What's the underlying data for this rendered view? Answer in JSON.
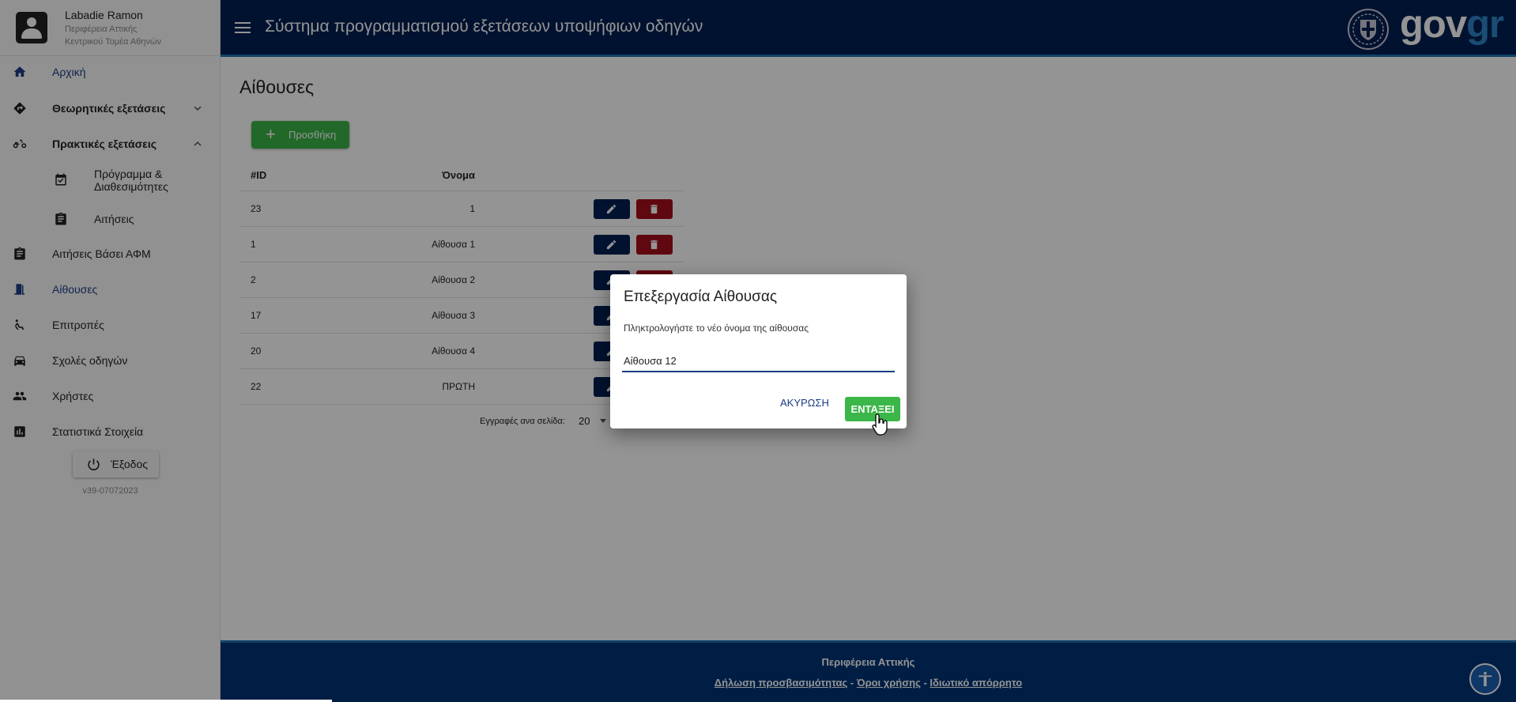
{
  "user": {
    "name": "Labadie Ramon",
    "region": "Περιφέρεια Αττικής",
    "sector": "Κεντρικού Τομέα Αθηνών"
  },
  "nav": {
    "home": "Αρχική",
    "theory": "Θεωρητικές εξετάσεις",
    "practical": "Πρακτικές εξετάσεις",
    "schedule_line1": "Πρόγραμμα &",
    "schedule_line2": "Διαθεσιμότητες",
    "requests": "Αιτήσεις",
    "requests_afm": "Αιτήσεις Βάσει ΑΦΜ",
    "rooms": "Αίθουσες",
    "committees": "Επιτροπές",
    "schools": "Σχολές οδηγών",
    "users": "Χρήστες",
    "stats": "Στατιστικά Στοιχεία"
  },
  "logout_label": "Έξοδος",
  "version": "v39-07072023",
  "header": {
    "title": "Σύστημα προγραμματισμού εξετάσεων υποψήφιων οδηγών",
    "brand_gov": "gov",
    "brand_gr": "gr"
  },
  "page": {
    "title": "Αίθουσες",
    "add_label": "Προσθήκη"
  },
  "table": {
    "columns": [
      "#ID",
      "Όνομα"
    ],
    "rows": [
      {
        "id": "23",
        "name": "1"
      },
      {
        "id": "1",
        "name": "Αίθουσα 1"
      },
      {
        "id": "2",
        "name": "Αίθουσα 2"
      },
      {
        "id": "17",
        "name": "Αίθουσα 3"
      },
      {
        "id": "20",
        "name": "Αίθουσα 4"
      },
      {
        "id": "22",
        "name": "ΠΡΩΤΗ"
      }
    ]
  },
  "pager": {
    "label": "Εγγραφές ανα σελίδα:",
    "size": "20"
  },
  "footer": {
    "region": "Περιφέρεια Αττικής",
    "accessibility": "Δήλωση προσβασιμότητας",
    "sep": " - ",
    "terms": "Όροι χρήσης",
    "privacy": "Ιδιωτικό απόρρητο"
  },
  "dialog": {
    "title": "Επεξεργασία Αίθουσας",
    "text": "Πληκτρολογήστε το νέο όνομα της αίθουσας",
    "value": "Αίθουσα 12",
    "cancel": "ΑΚΥΡΩΣΗ",
    "ok": "ΕΝΤΑΞΕΙ"
  },
  "colors": {
    "header": "#002052",
    "footer": "#003476",
    "accent": "#1a3d86",
    "success": "#3bb648",
    "danger": "#a50e1b"
  }
}
